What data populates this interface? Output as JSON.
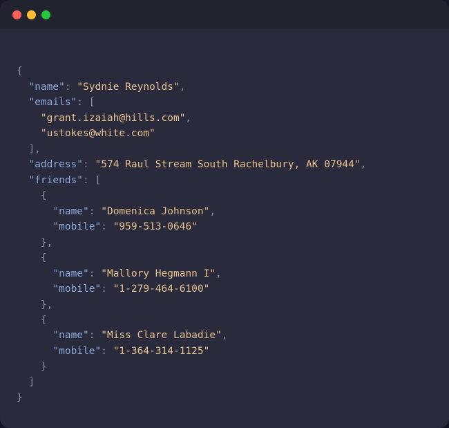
{
  "colors": {
    "bg_window": "#292b3d",
    "bg_titlebar": "#21232f",
    "dot_red": "#ff5f56",
    "dot_yellow": "#ffbd2e",
    "dot_green": "#27c93f",
    "punctuation": "#8a8fa3",
    "key": "#8ba8d8",
    "string": "#e8c28e"
  },
  "k": {
    "name": "\"name\"",
    "emails": "\"emails\"",
    "address": "\"address\"",
    "friends": "\"friends\"",
    "mobile": "\"mobile\""
  },
  "v": {
    "name": "\"Sydnie Reynolds\"",
    "email0": "\"grant.izaiah@hills.com\"",
    "email1": "\"ustokes@white.com\"",
    "address": "\"574 Raul Stream South Rachelbury, AK 07944\"",
    "friend0_name": "\"Domenica Johnson\"",
    "friend0_mobile": "\"959-513-0646\"",
    "friend1_name": "\"Mallory Hegmann I\"",
    "friend1_mobile": "\"1-279-464-6100\"",
    "friend2_name": "\"Miss Clare Labadie\"",
    "friend2_mobile": "\"1-364-314-1125\""
  },
  "p": {
    "open_brace": "{",
    "close_brace": "}",
    "close_brace_comma": "},",
    "open_bracket": "[",
    "close_bracket": "]",
    "close_bracket_comma": "],",
    "colon_sp": ": ",
    "comma": ","
  }
}
